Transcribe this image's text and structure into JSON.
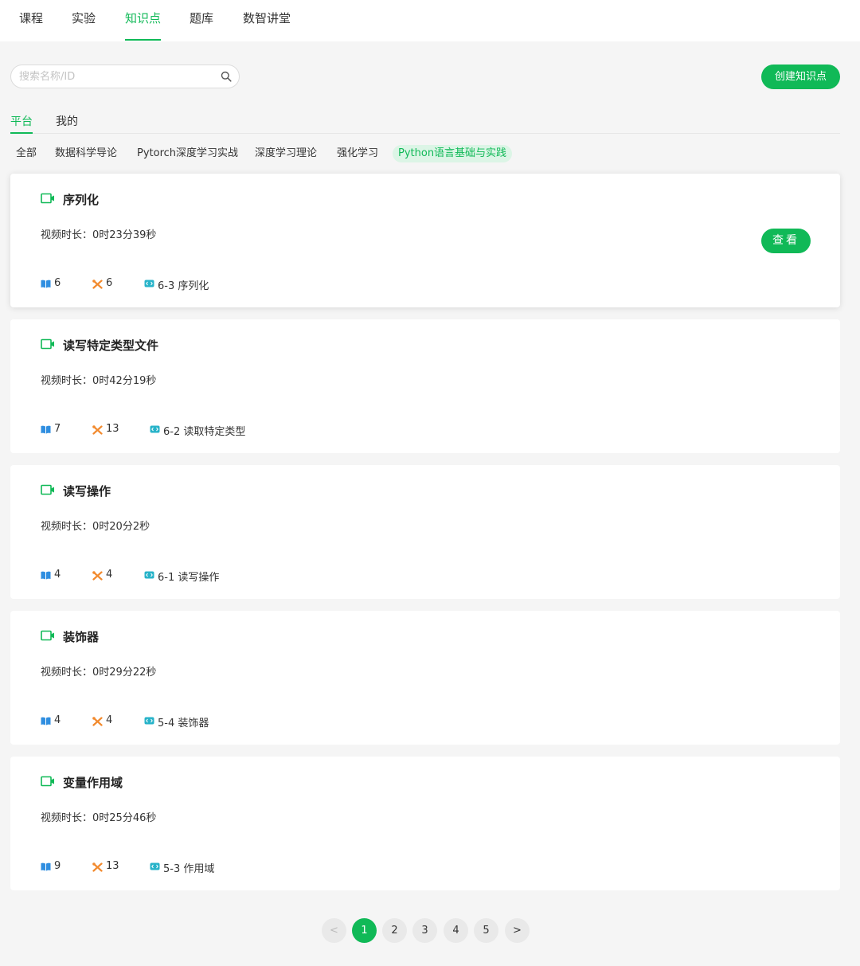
{
  "top_nav": {
    "items": [
      {
        "label": "课程"
      },
      {
        "label": "实验"
      },
      {
        "label": "知识点"
      },
      {
        "label": "题库"
      },
      {
        "label": "数智讲堂"
      }
    ],
    "active_index": 2
  },
  "search": {
    "placeholder": "搜索名称/ID",
    "value": ""
  },
  "create_button": {
    "label": "创建知识点"
  },
  "sub_tabs": {
    "items": [
      {
        "label": "平台"
      },
      {
        "label": "我的"
      }
    ],
    "active_index": 0
  },
  "filters": {
    "items": [
      {
        "label": "全部"
      },
      {
        "label": "数据科学导论"
      },
      {
        "label": "Pytorch深度学习实战"
      },
      {
        "label": "深度学习理论"
      },
      {
        "label": "强化学习"
      },
      {
        "label": "Python语言基础与实践"
      }
    ],
    "active_index": 5
  },
  "duration_label": "视频时长：",
  "view_button": {
    "label": "查看"
  },
  "cards": [
    {
      "title": "序列化",
      "duration": "0时23分39秒",
      "book_count": "6",
      "tool_count": "6",
      "chapter": "6-3 序列化"
    },
    {
      "title": "读写特定类型文件",
      "duration": "0时42分19秒",
      "book_count": "7",
      "tool_count": "13",
      "chapter": "6-2 读取特定类型"
    },
    {
      "title": "读写操作",
      "duration": "0时20分2秒",
      "book_count": "4",
      "tool_count": "4",
      "chapter": "6-1 读写操作"
    },
    {
      "title": "装饰器",
      "duration": "0时29分22秒",
      "book_count": "4",
      "tool_count": "4",
      "chapter": "5-4 装饰器"
    },
    {
      "title": "变量作用域",
      "duration": "0时25分46秒",
      "book_count": "9",
      "tool_count": "13",
      "chapter": "5-3 作用域"
    }
  ],
  "pagination": {
    "prev": "<",
    "next": ">",
    "pages": [
      "1",
      "2",
      "3",
      "4",
      "5"
    ],
    "current": "1"
  },
  "colors": {
    "accent": "#10b957",
    "book_icon": "#2f8ee0",
    "tool_icon": "#f28a2e",
    "chapter_icon": "#27b3c9"
  }
}
